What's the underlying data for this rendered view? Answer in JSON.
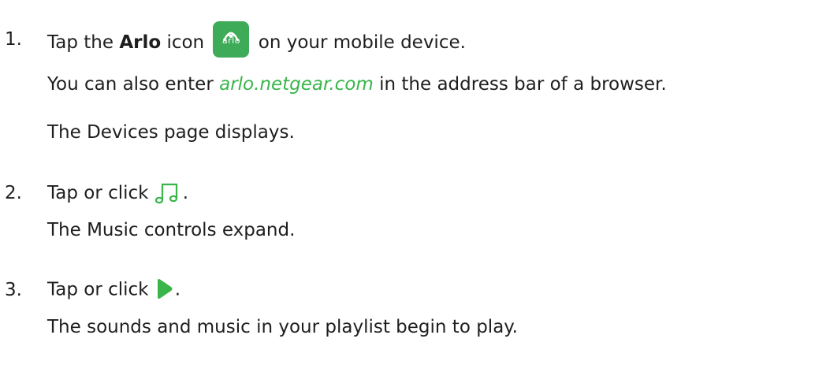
{
  "steps": [
    {
      "number": "1.",
      "pre": "Tap the ",
      "bold": "Arlo",
      "mid": " icon ",
      "post": " on your mobile device.",
      "icon": "arlo-app-icon",
      "icon_wordmark": "arlo"
    },
    {
      "number": "2.",
      "pre": "Tap or click ",
      "post": ".",
      "icon": "music-note-icon"
    },
    {
      "number": "3.",
      "pre": "Tap or click ",
      "post": ".",
      "icon": "play-icon"
    }
  ],
  "notes": {
    "also_pre": "You can also enter ",
    "also_link": "arlo.netgear.com",
    "also_post": " in the address bar of a browser.",
    "devices": "The Devices page displays.",
    "music_expand": "The Music controls expand.",
    "playlist": "The sounds and music in your playlist begin to play."
  },
  "colors": {
    "accent": "#39b54a",
    "icon_bg": "#3dab57",
    "text": "#1e1e1e"
  }
}
